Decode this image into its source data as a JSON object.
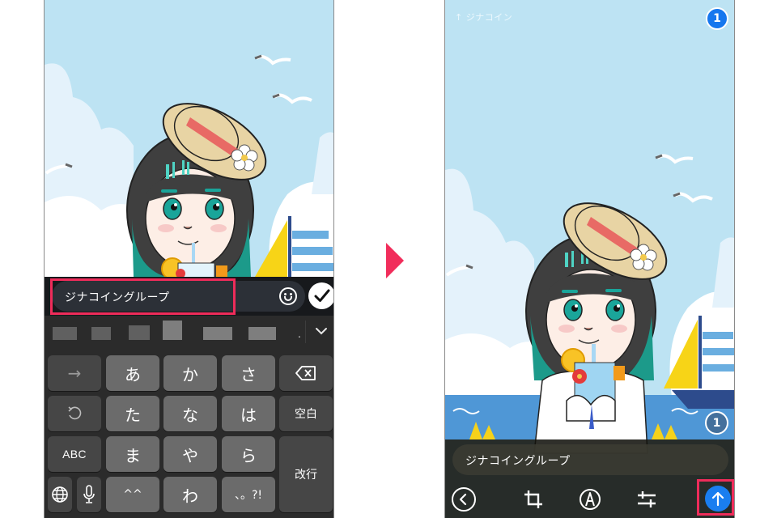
{
  "left_screen": {
    "caption_input": {
      "value": "ジナコイングループ"
    },
    "emoji_button": {
      "icon": "smiley-icon"
    },
    "done_button": {
      "icon": "checkmark-icon"
    },
    "suggestion_bar": {
      "collapse_icon": "chevron-down-icon",
      "dot": "."
    },
    "keyboard": {
      "rows": [
        [
          {
            "label": "→",
            "name": "key-next"
          },
          {
            "label": "あ",
            "name": "key-a"
          },
          {
            "label": "か",
            "name": "key-ka"
          },
          {
            "label": "さ",
            "name": "key-sa"
          },
          {
            "label": "",
            "name": "key-backspace",
            "icon": "backspace-icon"
          }
        ],
        [
          {
            "label": "",
            "name": "key-undo",
            "icon": "undo-icon"
          },
          {
            "label": "た",
            "name": "key-ta"
          },
          {
            "label": "な",
            "name": "key-na"
          },
          {
            "label": "は",
            "name": "key-ha"
          },
          {
            "label": "空白",
            "name": "key-space"
          }
        ],
        [
          {
            "label": "ABC",
            "name": "key-abc"
          },
          {
            "label": "ま",
            "name": "key-ma"
          },
          {
            "label": "や",
            "name": "key-ya"
          },
          {
            "label": "ら",
            "name": "key-ra"
          },
          {
            "label": "改行",
            "name": "key-return"
          }
        ],
        [
          {
            "label": "",
            "name": "key-globe",
            "icon": "globe-icon"
          },
          {
            "label": "",
            "name": "key-mic",
            "icon": "microphone-icon"
          },
          {
            "label": "^^",
            "name": "key-emoticon"
          },
          {
            "label": "わ",
            "name": "key-wa"
          },
          {
            "label": "、。?!",
            "name": "key-punctuation"
          }
        ]
      ]
    }
  },
  "transition_arrow": {
    "icon": "triangle-right-icon",
    "color": "#f12d5b"
  },
  "right_screen": {
    "reply_target": "↑ ジナコイン",
    "selected_count": "1",
    "image_index": "1",
    "caption_text": "ジナコイングループ",
    "toolbar": [
      {
        "name": "back-button",
        "icon": "chevron-left-circle-icon"
      },
      {
        "name": "crop-button",
        "icon": "crop-icon"
      },
      {
        "name": "draw-button",
        "icon": "pen-icon"
      },
      {
        "name": "adjust-button",
        "icon": "sliders-icon"
      },
      {
        "name": "send-button",
        "icon": "arrow-up-icon"
      }
    ]
  },
  "colors": {
    "highlight": "#ee2c5a",
    "accent_blue": "#1a7ef0",
    "sky": "#bde3f3"
  }
}
